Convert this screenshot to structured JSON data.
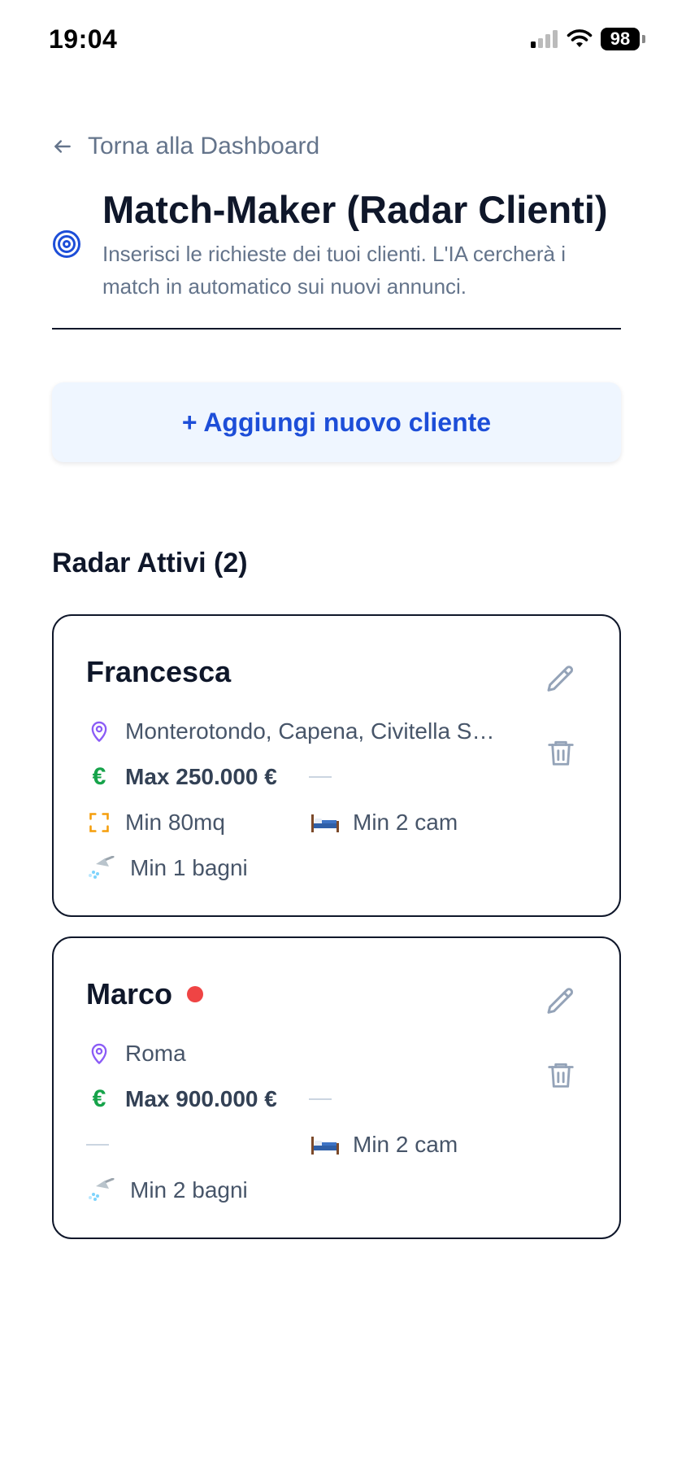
{
  "status_bar": {
    "time": "19:04",
    "battery": "98"
  },
  "nav": {
    "back_label": "Torna alla Dashboard"
  },
  "header": {
    "title": "Match-Maker (Radar Clienti)",
    "subtitle": "Inserisci le richieste dei tuoi clienti. L'IA cercherà i match in automatico sui nuovi annunci."
  },
  "add_button_label": "+ Aggiungi nuovo cliente",
  "section": {
    "title": "Radar Attivi (2)"
  },
  "clients": [
    {
      "name": "Francesca",
      "has_alert": false,
      "location": "Monterotondo, Capena, Civitella S…",
      "price": "Max 250.000 €",
      "size": "Min 80mq",
      "rooms": "Min 2 cam",
      "bathrooms": "Min 1 bagni"
    },
    {
      "name": "Marco",
      "has_alert": true,
      "location": "Roma",
      "price": "Max 900.000 €",
      "size": "",
      "rooms": "Min 2 cam",
      "bathrooms": "Min 2 bagni"
    }
  ],
  "icons": {
    "location": "map-pin-icon",
    "price": "euro-icon",
    "size": "frame-icon",
    "rooms": "bed-icon",
    "bathrooms": "shower-icon",
    "edit": "pencil-icon",
    "delete": "trash-icon"
  },
  "colors": {
    "accent": "#1d4ed8",
    "button_bg": "#eff6ff",
    "muted_text": "#64748b",
    "price_green": "#16a34a",
    "pin_purple": "#8b5cf6",
    "size_orange": "#f59e0b",
    "alert_red": "#ef4444",
    "action_gray": "#94a3b8"
  }
}
